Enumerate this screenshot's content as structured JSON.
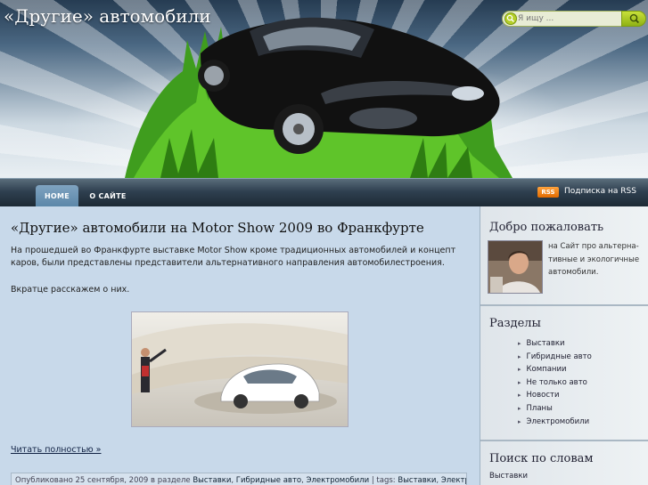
{
  "header": {
    "site_title": "«Другие» автомобили",
    "search_placeholder": "Я ищу ..."
  },
  "nav": {
    "tabs": [
      {
        "label": "HOME",
        "active": true
      },
      {
        "label": "О САЙТЕ",
        "active": false
      }
    ],
    "rss_badge": "RSS",
    "rss_label": "Подписка на RSS"
  },
  "post": {
    "title": "«Другие» автомобили на Motor Show 2009 во Франкфурте",
    "paragraph1": "На прошедшей во Франкфурте выставке Motor Show кроме традиционных автомобилей и концепт каров, были представлены представители альтернативного направления автомобилестроения.",
    "paragraph2": "Вкратце расскажем о них.",
    "read_more": "Читать полностью »",
    "meta": {
      "published": "Опубликовано 25 сентября, 2009 в разделе",
      "categories": [
        "Выставки",
        "Гибридные авто",
        "Электромобили"
      ],
      "tags_label": "tags:",
      "tags": [
        "Выставки",
        "Электромобил"
      ]
    }
  },
  "sidebar": {
    "welcome_title": "Добро пожаловать",
    "welcome_text": "на Сайт про альтерна-тивные и экологичные автомобили.",
    "sections_title": "Разделы",
    "categories": [
      "Выставки",
      "Гибридные авто",
      "Компании",
      "Не только авто",
      "Новости",
      "Планы",
      "Электромобили"
    ],
    "search_words_title": "Поиск по словам",
    "tag_small": "Выставки"
  },
  "colors": {
    "accent_green": "#8fb214",
    "rss_orange": "#e36b00",
    "main_bg": "#c8d9ea"
  }
}
